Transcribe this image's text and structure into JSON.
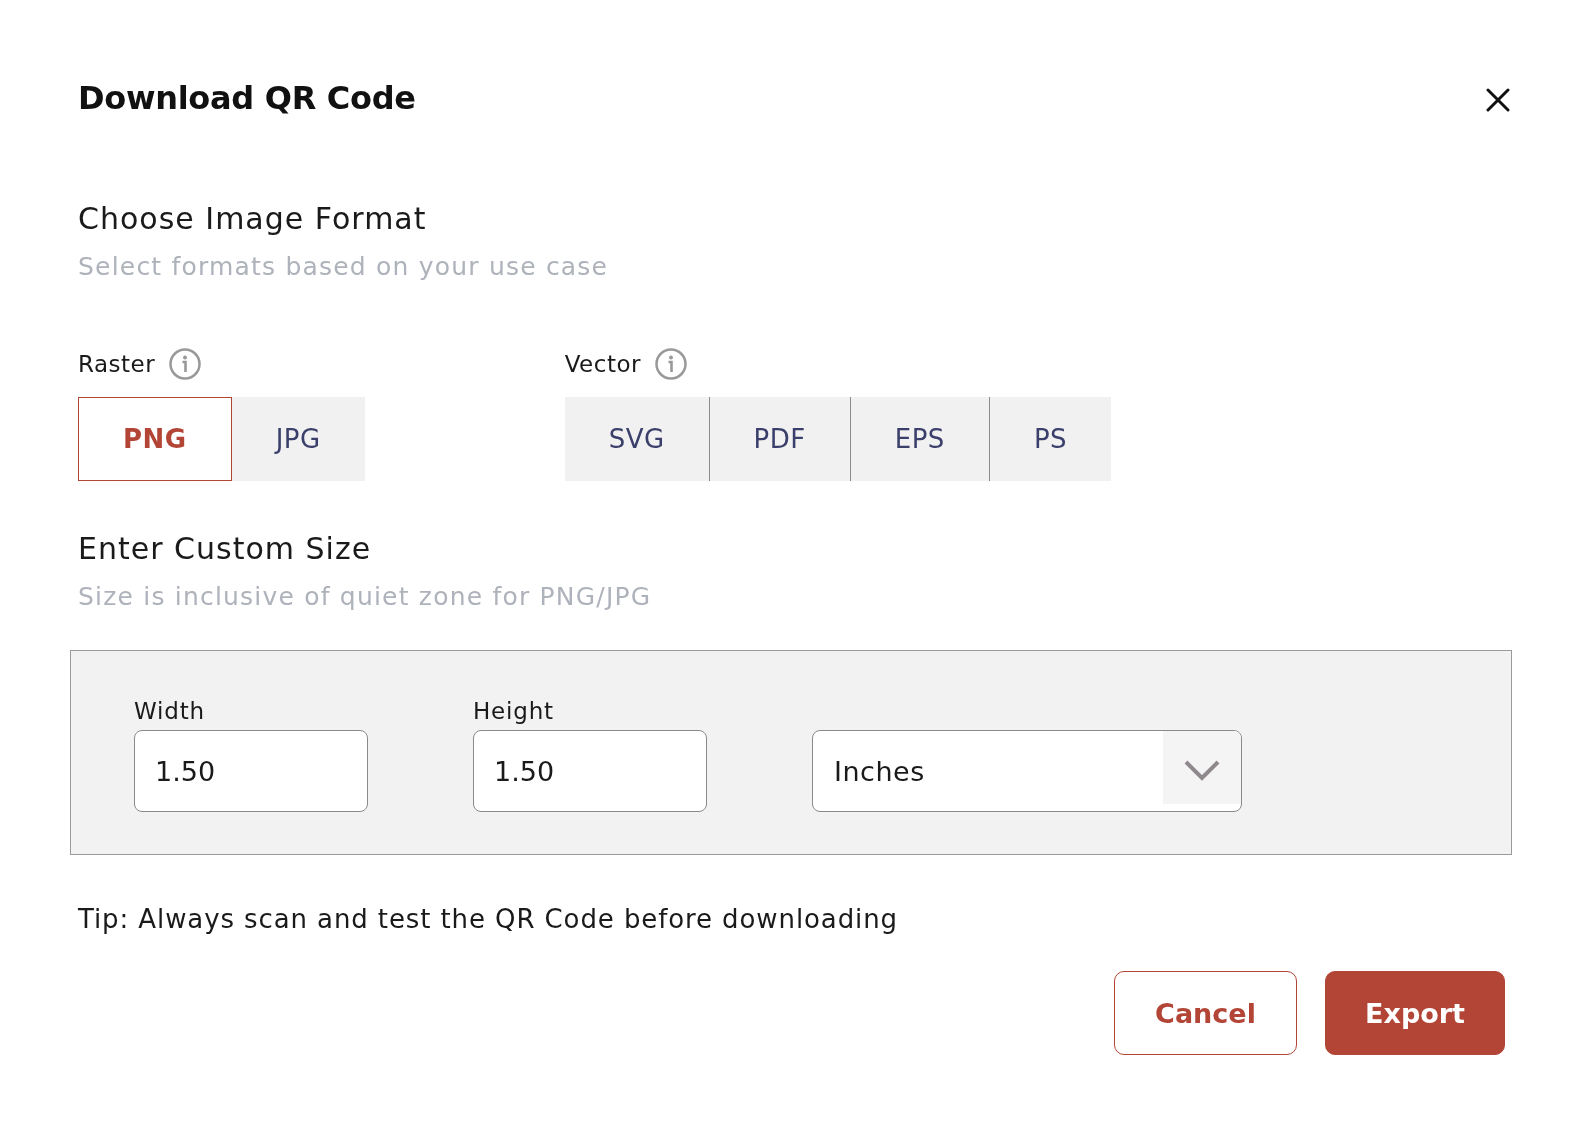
{
  "dialog": {
    "title": "Download QR Code"
  },
  "format_section": {
    "heading": "Choose Image Format",
    "subtitle": "Select formats based on your use case"
  },
  "format_groups": [
    {
      "label": "Raster",
      "formats": [
        {
          "label": "PNG",
          "selected": true
        },
        {
          "label": "JPG",
          "selected": false
        }
      ]
    },
    {
      "label": "Vector",
      "formats": [
        {
          "label": "SVG",
          "selected": false
        },
        {
          "label": "PDF",
          "selected": false
        },
        {
          "label": "EPS",
          "selected": false
        },
        {
          "label": "PS",
          "selected": false
        }
      ]
    }
  ],
  "size_section": {
    "heading": "Enter Custom Size",
    "subtitle": "Size is inclusive of quiet zone for PNG/JPG"
  },
  "size_fields": [
    {
      "label": "Width",
      "value": "1.50"
    },
    {
      "label": "Height",
      "value": "1.50"
    }
  ],
  "unit_select": {
    "value": "Inches"
  },
  "tip": "Tip: Always scan and test the QR Code before downloading",
  "buttons": [
    {
      "label": "Cancel",
      "kind": "secondary"
    },
    {
      "label": "Export",
      "kind": "primary"
    }
  ]
}
